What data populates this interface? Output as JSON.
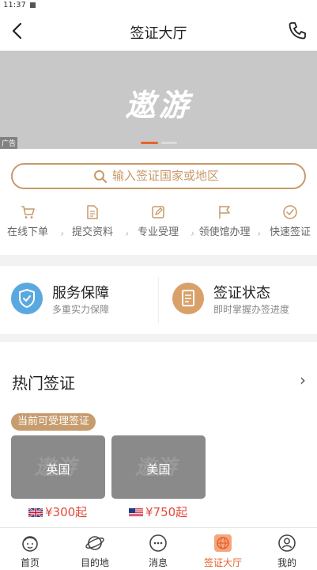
{
  "status_bar": {
    "time": "11:37"
  },
  "header": {
    "title": "签证大厅"
  },
  "banner": {
    "logo_text": "遨游",
    "ad_label": "广告"
  },
  "search": {
    "placeholder": "输入签证国家或地区"
  },
  "steps": [
    {
      "label": "在线下单",
      "icon": "cart-icon"
    },
    {
      "label": "提交资料",
      "icon": "document-icon"
    },
    {
      "label": "专业受理",
      "icon": "edit-icon"
    },
    {
      "label": "领使馆办理",
      "icon": "flag-icon"
    },
    {
      "label": "快速签证",
      "icon": "check-circle-icon"
    }
  ],
  "services": [
    {
      "title": "服务保障",
      "subtitle": "多重实力保障",
      "icon": "shield-icon",
      "color": "#5aa8e0"
    },
    {
      "title": "签证状态",
      "subtitle": "即时掌握办签进度",
      "icon": "clipboard-icon",
      "color": "#d9a06a"
    }
  ],
  "hot": {
    "title": "热门签证",
    "more": "›",
    "tag": "当前可受理签证",
    "cards": [
      {
        "name": "英国",
        "price": "¥300起",
        "flag": "uk-flag-icon"
      },
      {
        "name": "美国",
        "price": "¥750起",
        "flag": "us-flag-icon"
      }
    ],
    "card_watermark": "遨游"
  },
  "tabbar": {
    "tabs": [
      {
        "label": "首页",
        "icon": "home-face-icon",
        "active": false
      },
      {
        "label": "目的地",
        "icon": "planet-icon",
        "active": false
      },
      {
        "label": "消息",
        "icon": "message-icon",
        "active": false
      },
      {
        "label": "签证大厅",
        "icon": "globe-icon",
        "active": true
      },
      {
        "label": "我的",
        "icon": "profile-icon",
        "active": false
      }
    ]
  },
  "colors": {
    "accent": "#e8632b",
    "gold": "#c69a6a",
    "price": "#e2483a"
  }
}
